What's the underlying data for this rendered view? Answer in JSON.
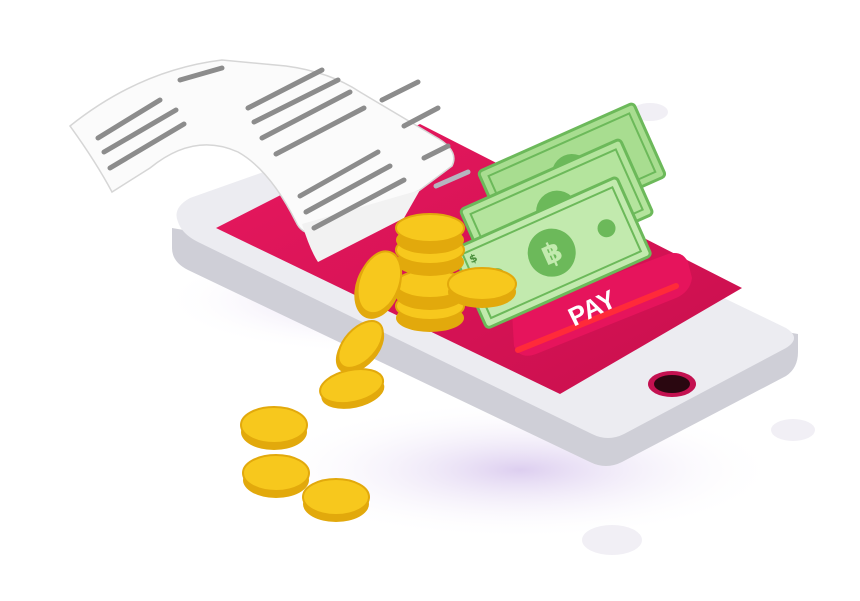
{
  "illustration": {
    "pay_button_label": "PAY",
    "banknote_symbol": "$",
    "center_symbol": "฿",
    "colors": {
      "screen": "#dc1558",
      "phone_body": "#e9e9ee",
      "phone_edge": "#cfcfd7",
      "coin": "#f7c81d",
      "coin_dark": "#e2a90c",
      "banknote": "#b8e6a3",
      "banknote_dark": "#6cb95a",
      "receipt": "#fafafa",
      "receipt_lines": "#8c8c8c",
      "accent_red": "#ff2a3a",
      "shadow": "#e7dcf3"
    },
    "icons": {
      "phone": "smartphone-icon",
      "receipt": "receipt-icon",
      "coins": "coin-icon",
      "banknotes": "banknote-icon",
      "home_button": "home-button-icon"
    }
  }
}
